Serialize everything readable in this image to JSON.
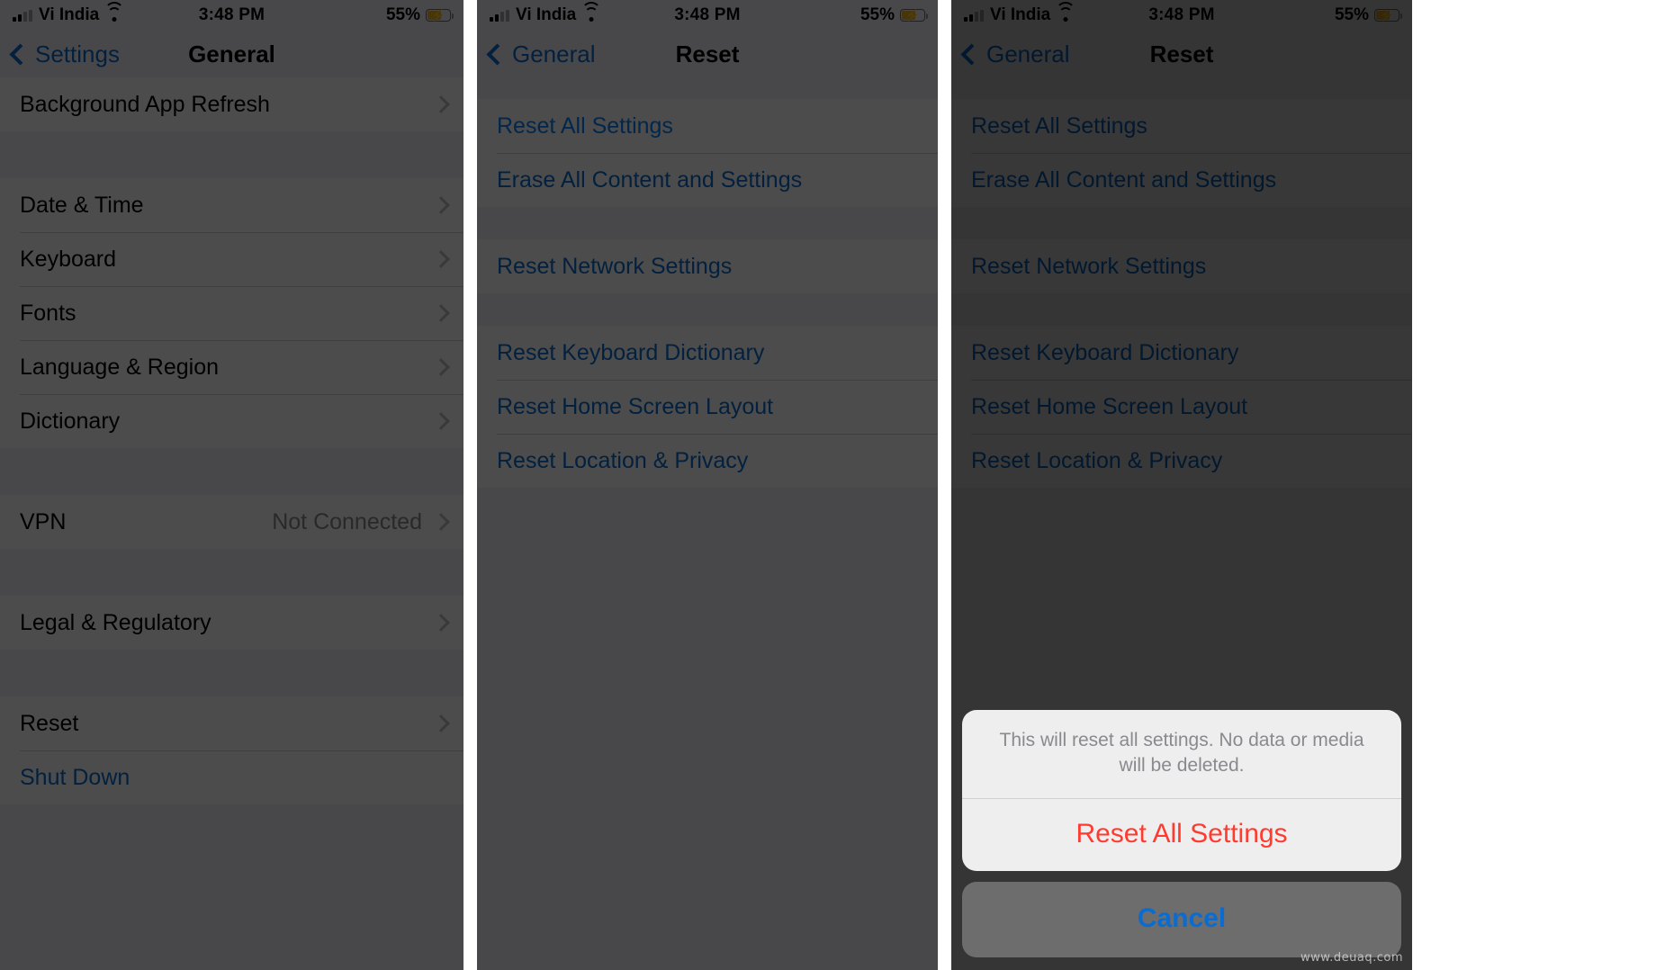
{
  "status_bar": {
    "carrier": "Vi India",
    "time": "3:48 PM",
    "battery_percent": "55%",
    "wifi_icon": "wifi-icon",
    "signal_icon": "signal-bars-icon",
    "battery_icon": "battery-charging-icon"
  },
  "panel1": {
    "nav": {
      "back_label": "Settings",
      "title": "General"
    },
    "rows": [
      {
        "label": "Background App Refresh",
        "value": "",
        "type": "disclosure"
      },
      {
        "label": "Date & Time",
        "value": "",
        "type": "disclosure"
      },
      {
        "label": "Keyboard",
        "value": "",
        "type": "disclosure"
      },
      {
        "label": "Fonts",
        "value": "",
        "type": "disclosure"
      },
      {
        "label": "Language & Region",
        "value": "",
        "type": "disclosure"
      },
      {
        "label": "Dictionary",
        "value": "",
        "type": "disclosure"
      },
      {
        "label": "VPN",
        "value": "Not Connected",
        "type": "disclosure"
      },
      {
        "label": "Legal & Regulatory",
        "value": "",
        "type": "disclosure"
      },
      {
        "label": "Reset",
        "value": "",
        "type": "disclosure"
      },
      {
        "label": "Shut Down",
        "value": "",
        "type": "link"
      }
    ]
  },
  "panel2": {
    "nav": {
      "back_label": "General",
      "title": "Reset"
    },
    "rows": [
      {
        "label": "Reset All Settings"
      },
      {
        "label": "Erase All Content and Settings"
      },
      {
        "label": "Reset Network Settings"
      },
      {
        "label": "Reset Keyboard Dictionary"
      },
      {
        "label": "Reset Home Screen Layout"
      },
      {
        "label": "Reset Location & Privacy"
      }
    ]
  },
  "panel3": {
    "nav": {
      "back_label": "General",
      "title": "Reset"
    },
    "rows": [
      {
        "label": "Reset All Settings"
      },
      {
        "label": "Erase All Content and Settings"
      },
      {
        "label": "Reset Network Settings"
      },
      {
        "label": "Reset Keyboard Dictionary"
      },
      {
        "label": "Reset Home Screen Layout"
      },
      {
        "label": "Reset Location & Privacy"
      }
    ],
    "action_sheet": {
      "message": "This will reset all settings. No data or media will be deleted.",
      "destructive_label": "Reset All Settings",
      "cancel_label": "Cancel"
    }
  },
  "watermark": "www.deuaq.com",
  "colors": {
    "accent_blue": "#0a6cd0",
    "highlight_blue": "#0a84ff",
    "destructive_red": "#ff3b30",
    "battery_yellow": "#f0b323",
    "dim_overlay": "rgba(0,0,0,0.70)"
  }
}
